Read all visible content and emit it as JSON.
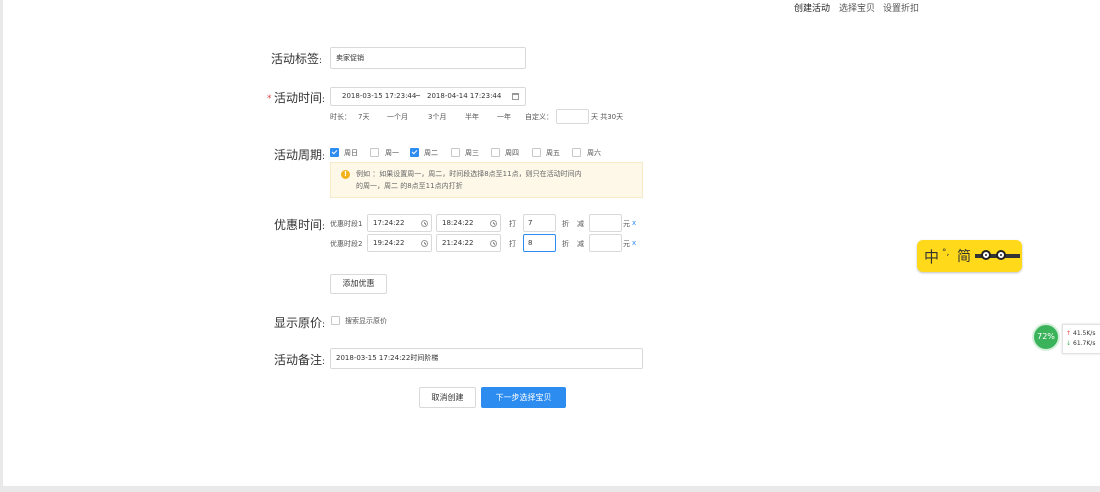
{
  "steps": [
    "创建活动",
    "选择宝贝",
    "设置折扣"
  ],
  "labels": {
    "tag": "活动标签",
    "time": "活动时间",
    "period": "活动周期",
    "discount_time": "优惠时间",
    "show_price": "显示原价",
    "note": "活动备注",
    "colon": ":"
  },
  "required_mark": "*",
  "tag_value": "卖家促销",
  "time_range": {
    "start": "2018-03-15 17:23:44",
    "separator": "~",
    "end": "2018-04-14 17:23:44"
  },
  "duration": {
    "label": "时长：",
    "options": [
      "7天",
      "一个月",
      "3个月",
      "半年",
      "一年"
    ],
    "custom_label": "自定义：",
    "custom_value": "",
    "suffix": "天 共30天"
  },
  "weekdays": [
    {
      "label": "周日",
      "checked": true
    },
    {
      "label": "周一",
      "checked": false
    },
    {
      "label": "周二",
      "checked": true
    },
    {
      "label": "周三",
      "checked": false
    },
    {
      "label": "周四",
      "checked": false
    },
    {
      "label": "周五",
      "checked": false
    },
    {
      "label": "周六",
      "checked": false
    }
  ],
  "tip": {
    "icon": "!",
    "line1": "例如 ：如果设置周一，周二，时间段选择8点至11点，则只在活动时间内",
    "line2": "的周一，周二 的8点至11点内打折"
  },
  "periods": [
    {
      "label": "优惠时段1",
      "start": "17:24:22",
      "end": "18:24:22",
      "discount_label": "打",
      "discount": "7",
      "unit": "折",
      "minus_label": "减",
      "minus": "",
      "currency": "元",
      "remove": "x"
    },
    {
      "label": "优惠时段2",
      "start": "19:24:22",
      "end": "21:24:22",
      "discount_label": "打",
      "discount": "8",
      "unit": "折",
      "minus_label": "减",
      "minus": "",
      "currency": "元",
      "remove": "x"
    }
  ],
  "add_button": "添加优惠",
  "show_price_option": "搜索显示原价",
  "note_value": "2018-03-15 17:24:22时间阶梯",
  "buttons": {
    "cancel": "取消创建",
    "next": "下一步选择宝贝"
  },
  "ime": {
    "lang": "中",
    "punct": "°,",
    "mode": "简"
  },
  "netmon": {
    "percent": "72%",
    "up": "41.5K/s",
    "down": "61.7K/s",
    "up_arrow": "↑",
    "down_arrow": "↓"
  },
  "colors": {
    "accent": "#2d8cf0",
    "required": "#e04545",
    "tip_bg": "#fdf8e8",
    "ime_bg": "#ffd91a",
    "gauge": "#3bb35b"
  }
}
